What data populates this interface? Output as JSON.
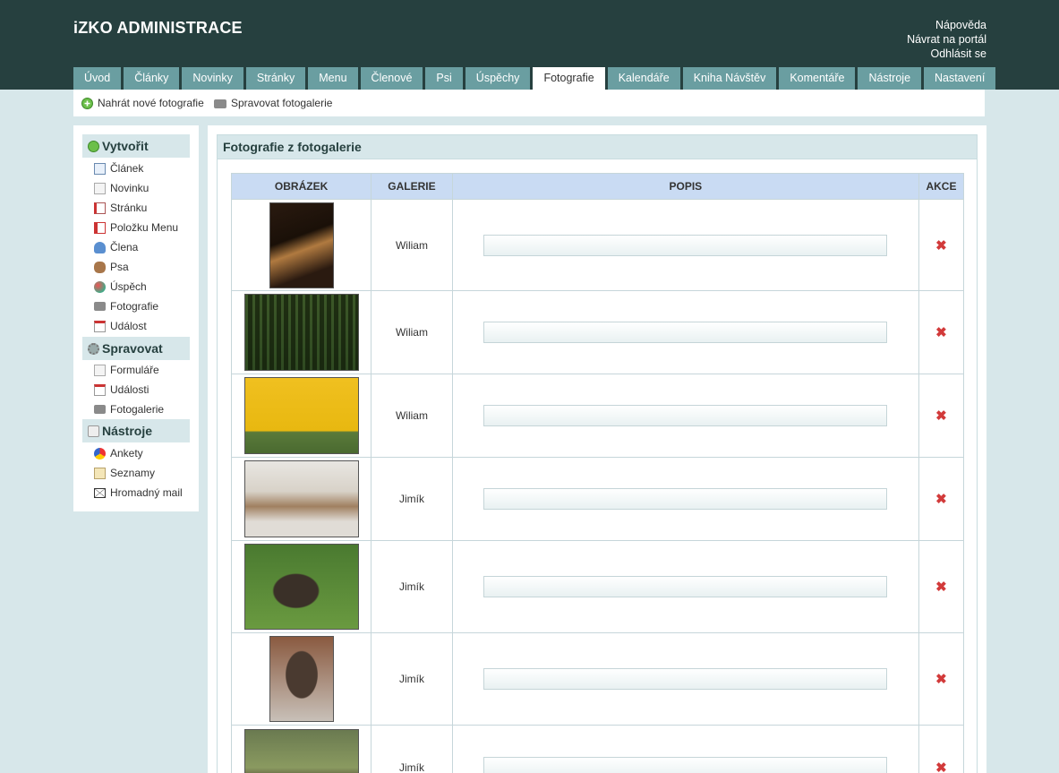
{
  "app": {
    "title": "iZKO ADMINISTRACE"
  },
  "toplinks": [
    "Nápověda",
    "Návrat na portál",
    "Odhlásit se"
  ],
  "nav": {
    "tabs": [
      "Úvod",
      "Články",
      "Novinky",
      "Stránky",
      "Menu",
      "Členové",
      "Psi",
      "Úspěchy",
      "Fotografie",
      "Kalendáře",
      "Kniha Návštěv",
      "Komentáře",
      "Nástroje",
      "Nastavení"
    ],
    "active": "Fotografie"
  },
  "subnav": {
    "upload": "Nahrát nové fotografie",
    "manage": "Spravovat fotogalerie"
  },
  "sidebar": {
    "create": {
      "title": "Vytvořit",
      "items": [
        "Článek",
        "Novinku",
        "Stránku",
        "Položku Menu",
        "Člena",
        "Psa",
        "Úspěch",
        "Fotografie",
        "Událost"
      ]
    },
    "manage": {
      "title": "Spravovat",
      "items": [
        "Formuláře",
        "Události",
        "Fotogalerie"
      ]
    },
    "tools": {
      "title": "Nástroje",
      "items": [
        "Ankety",
        "Seznamy",
        "Hromadný mail"
      ]
    }
  },
  "panel": {
    "title": "Fotografie z fotogalerie"
  },
  "table": {
    "headers": [
      "Obrázek",
      "Galerie",
      "Popis",
      "Akce"
    ],
    "rows": [
      {
        "gallery": "Wiliam",
        "description": ""
      },
      {
        "gallery": "Wiliam",
        "description": ""
      },
      {
        "gallery": "Wiliam",
        "description": ""
      },
      {
        "gallery": "Jimík",
        "description": ""
      },
      {
        "gallery": "Jimík",
        "description": ""
      },
      {
        "gallery": "Jimík",
        "description": ""
      },
      {
        "gallery": "Jimík",
        "description": ""
      }
    ]
  },
  "colors": {
    "header_bg": "#26403f",
    "tab_bg": "#6a9ea1",
    "page_bg": "#d7e7ea",
    "table_header_bg": "#c9dbf3",
    "delete": "#d23a3a"
  }
}
